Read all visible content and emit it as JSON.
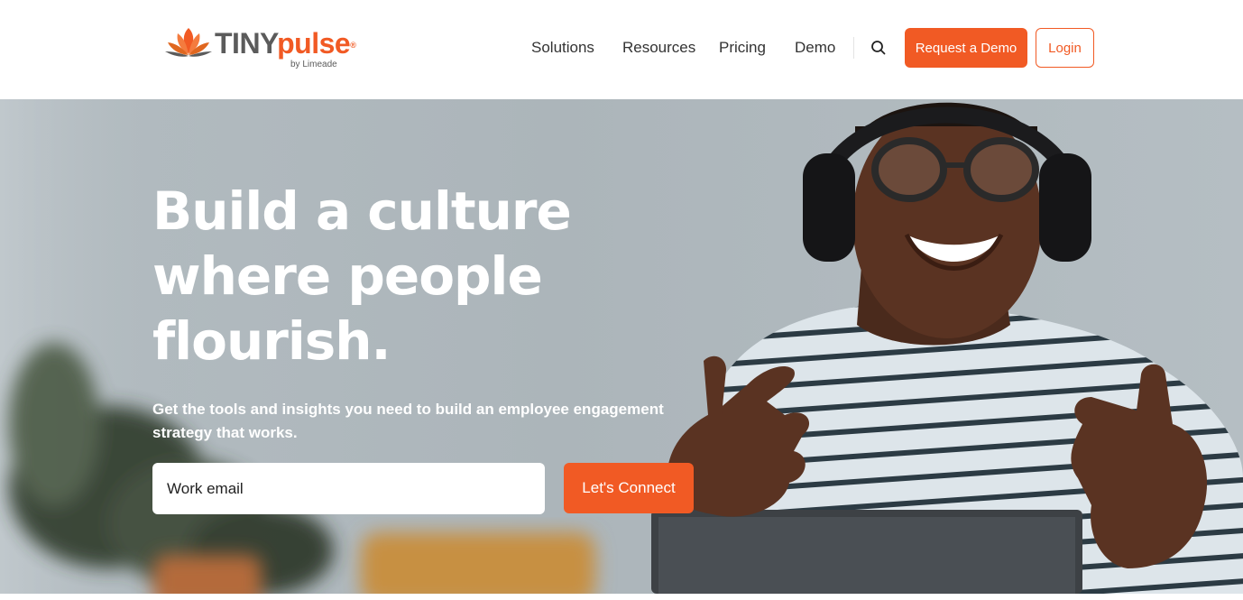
{
  "brand": {
    "name_part1": "TINY",
    "name_part2": "pulse",
    "registered": "®",
    "byline": "by Limeade",
    "accent_color": "#f15a24",
    "gray_color": "#5b5b5b"
  },
  "nav": {
    "items": [
      {
        "label": "Solutions"
      },
      {
        "label": "Resources"
      },
      {
        "label": "Pricing"
      },
      {
        "label": "Demo"
      }
    ],
    "search_icon": "search-icon",
    "request_demo_label": "Request a Demo",
    "login_label": "Login"
  },
  "hero": {
    "title_lines": [
      "Build a culture",
      "where people",
      "flourish."
    ],
    "subtitle": "Get the tools and insights you need to build an employee engagement strategy that works.",
    "email_placeholder": "Work email",
    "cta_label": "Let's Connect",
    "photo_subject": "smiling man with headphones and glasses at laptop"
  }
}
